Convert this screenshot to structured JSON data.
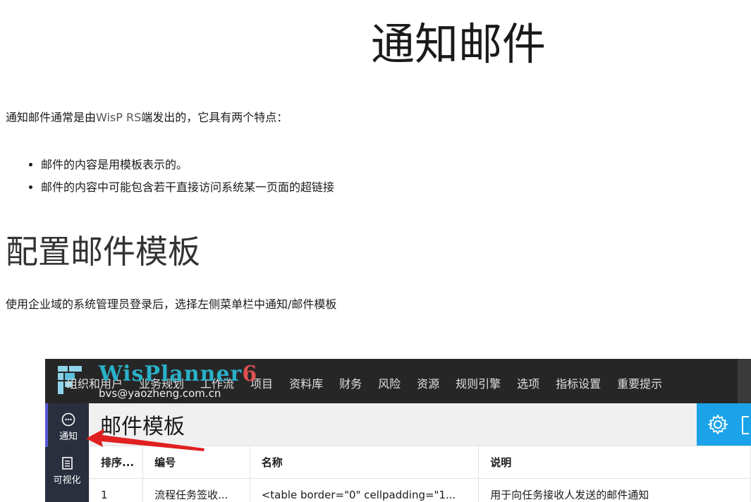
{
  "doc": {
    "title": "通知邮件",
    "intro_prefix": "通知邮件通常是由",
    "intro_brand": "WisP RS",
    "intro_suffix": "端发出的，它具有两个特点：",
    "bullets": [
      "邮件的内容是用模板表示的。",
      "邮件的内容中可能包含若干直接访问系统某一页面的超链接"
    ],
    "section_title": "配置邮件模板",
    "instructions": "使用企业域的系统管理员登录后，选择左侧菜单栏中通知/邮件模板"
  },
  "screenshot": {
    "logo_main": "WisPlanner",
    "logo_version": "6",
    "user_email": "bvs@yaozheng.com.cn",
    "nav": [
      "组织和用户",
      "业务规划",
      "工作流",
      "项目",
      "资料库",
      "财务",
      "风险",
      "资源",
      "规则引擎",
      "选项",
      "指标设置",
      "重要提示"
    ],
    "sidebar": [
      {
        "label": "通知",
        "icon": "chat-icon"
      },
      {
        "label": "可视化",
        "icon": "document-icon"
      }
    ],
    "page_title": "邮件模板",
    "table": {
      "headers": [
        "排序...",
        "编号",
        "名称",
        "说明"
      ],
      "rows": [
        [
          "1",
          "流程任务签收...",
          "<table border=\"0\" cellpadding=\"1...",
          "用于向任务接收人发送的邮件通知"
        ]
      ]
    },
    "colors": {
      "topbar": "#262626",
      "sidebar": "#2a2f3e",
      "accent": "#1aa3e8",
      "arrow": "#e02020"
    }
  }
}
